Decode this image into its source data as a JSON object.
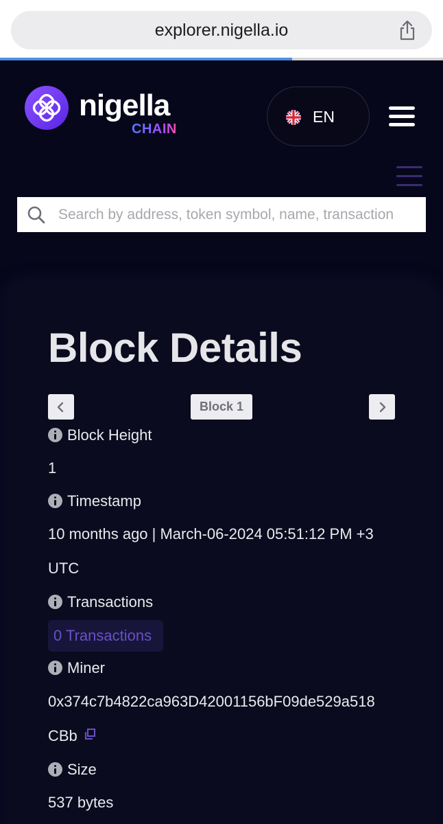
{
  "browser": {
    "url": "explorer.nigella.io",
    "load_progress": 0.66
  },
  "header": {
    "logo_name": "nigella",
    "logo_sub": "CHAIN",
    "language": "EN",
    "flag_icon": "uk-flag-icon",
    "menu_icon": "hamburger-menu-icon"
  },
  "search": {
    "placeholder": "Search by address, token symbol, name, transaction"
  },
  "block": {
    "title": "Block Details",
    "nav_label": "Block 1",
    "fields": {
      "height_label": "Block Height",
      "height_value": "1",
      "timestamp_label": "Timestamp",
      "timestamp_line1": "10 months ago | March-06-2024 05:51:12 PM +3",
      "timestamp_line2": "UTC",
      "transactions_label": "Transactions",
      "transactions_value": "0 Transactions",
      "miner_label": "Miner",
      "miner_line1": "0x374c7b4822ca963D42001156bF09de529a518",
      "miner_line2": "CBb",
      "size_label": "Size",
      "size_value": "537 bytes"
    }
  },
  "colors": {
    "background": "#07071b",
    "brand_purple": "#6a3cf0",
    "link_purple": "#6a4fc8"
  }
}
